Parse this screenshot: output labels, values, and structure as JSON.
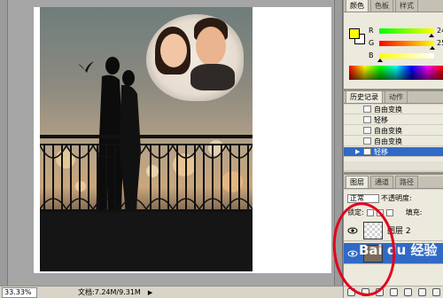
{
  "status_bar": {
    "zoom": "33.33%",
    "doc_size": "文档:7.24M/9.31M"
  },
  "color_panel": {
    "tabs": [
      "颜色",
      "色板",
      "样式"
    ],
    "foreground_color": "#ffff00",
    "background_color": "#ffffff",
    "sliders": [
      {
        "label": "R",
        "value": "24",
        "knob": 0.95
      },
      {
        "label": "G",
        "value": "25",
        "knob": 0.97
      },
      {
        "label": "B",
        "value": "",
        "knob": 0.02
      }
    ]
  },
  "history_panel": {
    "tabs": [
      "历史记录",
      "动作"
    ],
    "items": [
      {
        "label": "自由变换",
        "selected": false
      },
      {
        "label": "轻移",
        "selected": false
      },
      {
        "label": "自由变换",
        "selected": false
      },
      {
        "label": "自由变换",
        "selected": false
      },
      {
        "label": "轻移",
        "selected": true
      }
    ]
  },
  "layers_panel": {
    "tabs": [
      "图层",
      "通道",
      "路径"
    ],
    "blend_mode": "正常",
    "opacity_label": "不透明度:",
    "lock_label": "锁定:",
    "fill_label": "填充:",
    "layers": [
      {
        "name": "图层 2",
        "selected": false
      },
      {
        "name": "",
        "selected": true
      }
    ]
  },
  "watermark": "Bai du 经验",
  "colors": {
    "selection": "#316ac5",
    "panel_bg": "#ece9dd",
    "annotation": "#e3001b"
  }
}
